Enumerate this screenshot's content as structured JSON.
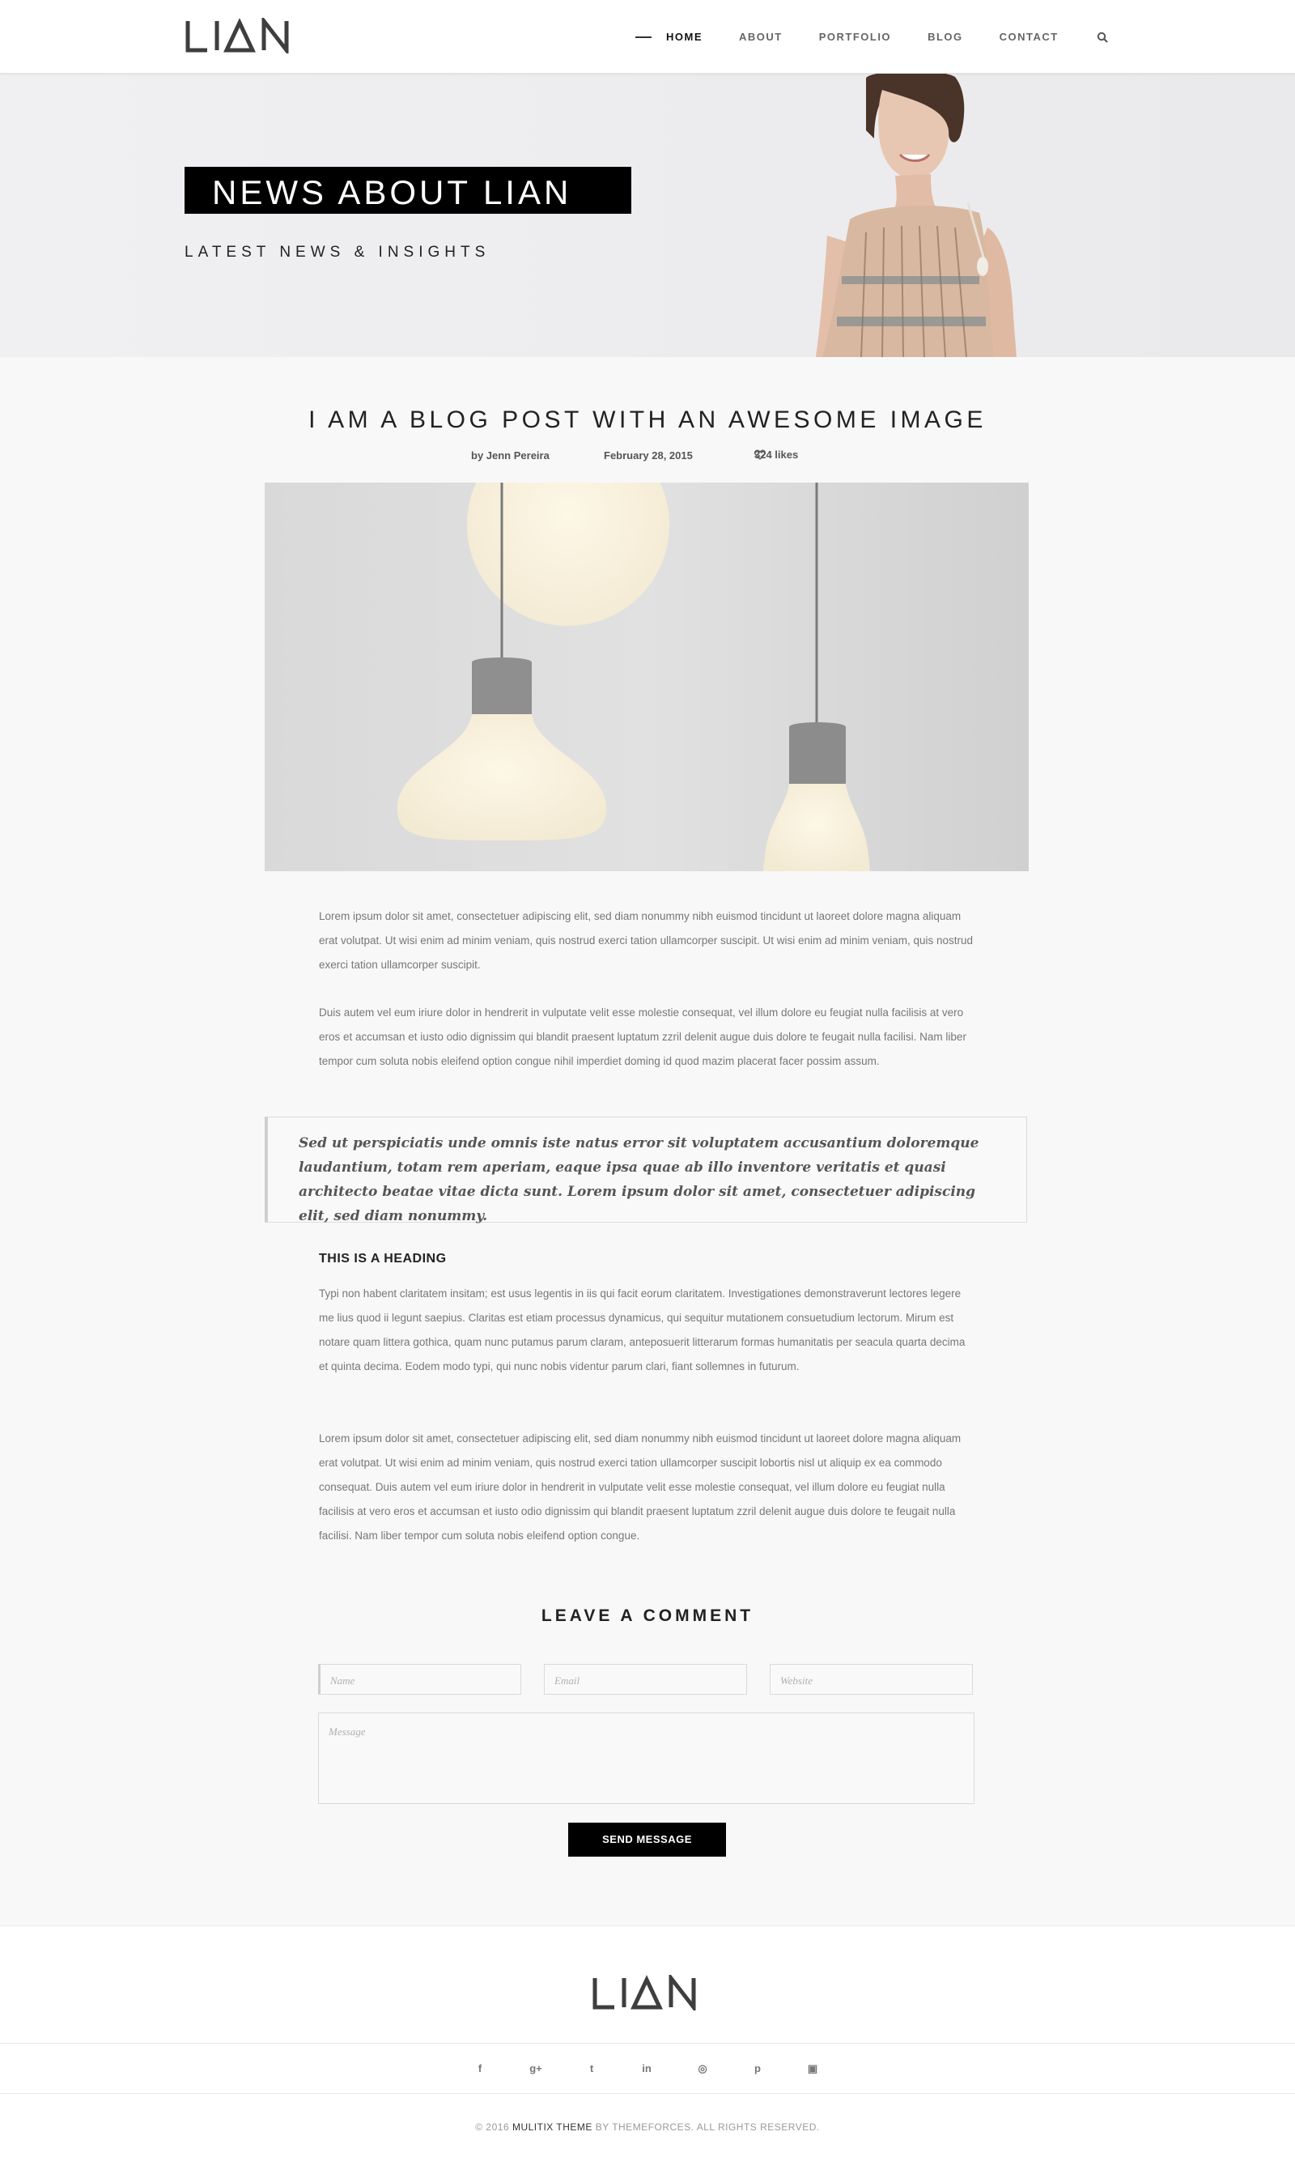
{
  "header": {
    "logo_text": "LIAN",
    "nav": [
      "HOME",
      "ABOUT",
      "PORTFOLIO",
      "BLOG",
      "CONTACT"
    ],
    "active": "HOME"
  },
  "hero": {
    "title": "NEWS ABOUT LIAN",
    "subtitle": "LATEST NEWS & INSIGHTS"
  },
  "post": {
    "title": "I AM A BLOG POST WITH AN AWESOME IMAGE",
    "author": "by Jenn Pereira",
    "date": "February 28, 2015",
    "likes": "324 likes",
    "paragraph_1": "Lorem ipsum dolor sit amet, consectetuer adipiscing elit, sed diam nonummy nibh euismod tincidunt ut laoreet dolore magna aliquam erat volutpat. Ut wisi enim ad minim veniam, quis nostrud exerci tation ullamcorper suscipit. Ut wisi enim ad minim veniam, quis nostrud exerci tation ullamcorper suscipit.",
    "paragraph_2": "Duis autem vel eum iriure dolor in hendrerit in vulputate velit esse molestie consequat, vel illum dolore eu feugiat nulla facilisis at vero eros et accumsan et iusto odio dignissim qui blandit praesent luptatum zzril delenit augue duis dolore te feugait nulla facilisi. Nam liber tempor cum soluta nobis eleifend option congue nihil imperdiet doming id quod mazim placerat facer possim assum.",
    "quote": "Sed ut perspiciatis unde omnis iste natus error sit voluptatem accusantium doloremque laudantium, totam rem aperiam, eaque ipsa quae ab illo inventore veritatis et quasi architecto beatae vitae dicta sunt. Lorem ipsum dolor sit amet, consectetuer adipiscing elit, sed diam nonummy.",
    "heading": "THIS IS A HEADING",
    "paragraph_3": "Typi non habent claritatem insitam; est usus legentis in iis qui facit eorum claritatem. Investigationes demonstraverunt lectores legere me lius quod ii legunt saepius. Claritas est etiam processus dynamicus, qui sequitur mutationem consuetudium lectorum. Mirum est notare quam littera gothica, quam nunc putamus parum claram, anteposuerit litterarum formas humanitatis per seacula quarta decima et quinta decima. Eodem modo typi, qui nunc nobis videntur parum clari, fiant sollemnes in futurum.",
    "paragraph_4": "Lorem ipsum dolor sit amet, consectetuer adipiscing elit, sed diam nonummy nibh euismod tincidunt ut laoreet dolore magna aliquam erat volutpat. Ut wisi enim ad minim veniam, quis nostrud exerci tation ullamcorper suscipit lobortis nisl ut aliquip ex ea commodo consequat. Duis autem vel eum iriure dolor in hendrerit in vulputate velit esse molestie consequat, vel illum dolore eu feugiat nulla facilisis at vero eros et accumsan et iusto odio dignissim qui blandit praesent luptatum zzril delenit augue duis dolore te feugait nulla facilisi. Nam liber tempor cum soluta nobis eleifend option congue."
  },
  "comment": {
    "title": "LEAVE A COMMENT",
    "name_placeholder": "Name",
    "email_placeholder": "Email",
    "website_placeholder": "Website",
    "message_placeholder": "Message",
    "send_label": "SEND MESSAGE"
  },
  "footer": {
    "logo_text": "LIAN",
    "social": [
      "facebook-icon",
      "google-plus-icon",
      "twitter-icon",
      "linkedin-icon",
      "dribbble-icon",
      "pinterest-icon",
      "instagram-icon"
    ],
    "social_glyphs": [
      "f",
      "g+",
      "t",
      "in",
      "◎",
      "p",
      "▣"
    ],
    "copyright_prefix": "© 2016",
    "copyright_theme": "MULITIX THEME",
    "copyright_suffix": "BY THEMEFORCES. ALL RIGHTS RESERVED."
  },
  "colors": {
    "accent": "#000000",
    "text": "#777777",
    "background": "#f8f8f8"
  }
}
